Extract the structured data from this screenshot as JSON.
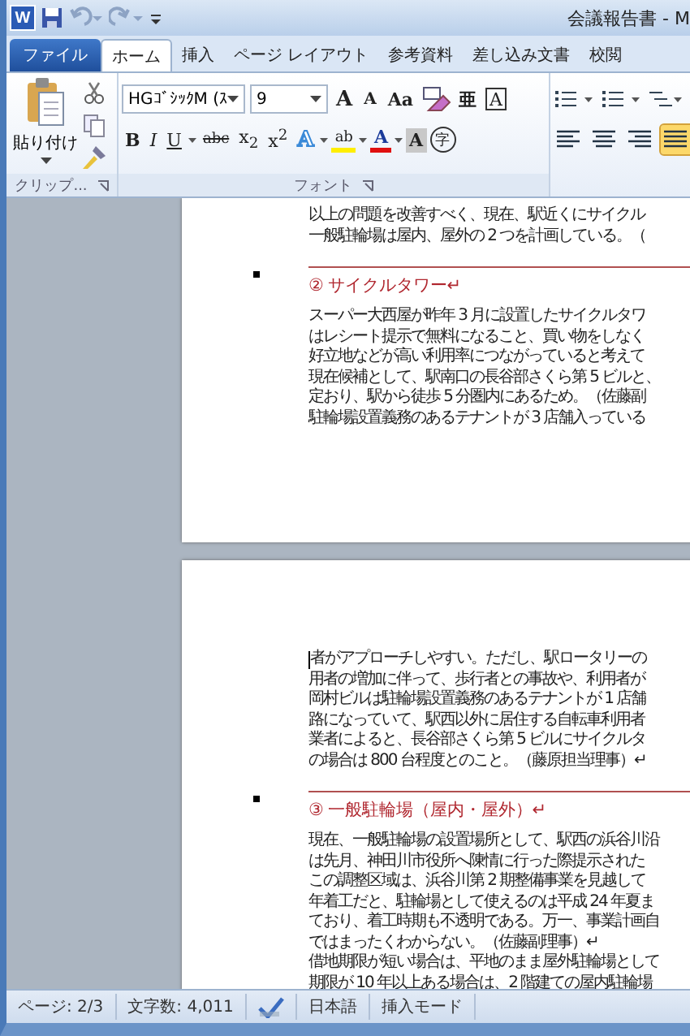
{
  "window": {
    "app_icon": "W",
    "title": "会議報告書 - M"
  },
  "tabs": [
    {
      "label": "ファイル",
      "kind": "file",
      "selected": false
    },
    {
      "label": "ホーム",
      "kind": "tab",
      "selected": true
    },
    {
      "label": "挿入",
      "kind": "tab",
      "selected": false
    },
    {
      "label": "ページ レイアウト",
      "kind": "tab",
      "selected": false
    },
    {
      "label": "参考資料",
      "kind": "tab",
      "selected": false
    },
    {
      "label": "差し込み文書",
      "kind": "tab",
      "selected": false
    },
    {
      "label": "校閲",
      "kind": "tab",
      "selected": false
    }
  ],
  "clipboard": {
    "paste_label": "貼り付け",
    "group_label": "クリップ..."
  },
  "font": {
    "font_name": "HGｺﾞｼｯｸM (ｽ",
    "font_size": "9",
    "group_label": "フォント",
    "row1": [
      {
        "label": "A",
        "kind": "grow"
      },
      {
        "label": "A",
        "kind": "shrink"
      },
      {
        "label": "Aa",
        "kind": "case"
      },
      {
        "kind": "clear"
      },
      {
        "label": "亜",
        "kind": "ruby"
      },
      {
        "label": "A",
        "kind": "border"
      }
    ],
    "row2": [
      {
        "label": "B",
        "kind": "bold"
      },
      {
        "label": "I",
        "kind": "italic"
      },
      {
        "label": "U",
        "kind": "underline"
      },
      {
        "label": "abc",
        "kind": "strike"
      },
      {
        "label": "x$_{2}$",
        "kind": "plain"
      },
      {
        "label": "x$^{2}$",
        "kind": "plain"
      },
      {
        "label": "A",
        "kind": "effects"
      },
      {
        "label": "ab",
        "kind": "highlight"
      },
      {
        "label": "A",
        "kind": "color"
      },
      {
        "label": "A",
        "kind": "shade"
      },
      {
        "label": "字",
        "kind": "enclose"
      }
    ]
  },
  "paragraph": {
    "align": [
      {
        "selected": false
      },
      {
        "selected": false
      },
      {
        "selected": false
      },
      {
        "selected": true
      }
    ]
  },
  "pages": [
    {
      "blocks": [
        {
          "kind": "body",
          "lines": [
            "以上の問題を改善すべく、現在、駅近くにサイクル",
            "一般駐輪場は屋内、屋外の 2 つを計画している。（"
          ]
        },
        {
          "kind": "heading",
          "text": "② サイクルタワー↵"
        },
        {
          "kind": "body",
          "lines": [
            "スーパー大西屋が昨年 3 月に設置したサイクルタワ",
            "はレシート提示で無料になること、買い物をしなく",
            "好立地などが高い利用率につながっていると考えて",
            "現在候補として、駅南口の長谷部さくら第 5 ビルと、",
            "定おり、駅から徒歩 5 分圏内にあるため。（佐藤副",
            "駐輪場設置義務のあるテナントが 3 店舗入っている"
          ]
        }
      ]
    },
    {
      "blocks": [
        {
          "kind": "body",
          "cursor": true,
          "lines": [
            "者がアプローチしやすい。ただし、駅ロータリーの",
            "用者の増加に伴って、歩行者との事故や、利用者が",
            "岡村ビルは駐輪場設置義務のあるテナントが 1 店舗",
            "路になっていて、駅西以外に居住する自転車利用者",
            "業者によると、長谷部さくら第 5 ビルにサイクルタ",
            "の場合は 800 台程度とのこと。（藤原担当理事）↵"
          ]
        },
        {
          "kind": "heading",
          "text": "③ 一般駐輪場（屋内・屋外）↵"
        },
        {
          "kind": "body",
          "lines": [
            "現在、一般駐輪場の設置場所として、駅西の浜谷川沿",
            "は先月、神田川市役所へ陳情に行った際提示された",
            "この調整区域は、浜谷川第 2 期整備事業を見越して",
            "年着工だと、駐輪場として使えるのは平成 24 年夏ま",
            "ており、着工時期も不透明である。万一、事業計画自",
            "ではまったくわからない。（佐藤副理事）↵",
            "借地期限が短い場合は、平地のまま屋外駐輪場として",
            "期限が 10 年以上ある場合は、2 階建ての屋内駐輪場"
          ]
        }
      ]
    }
  ],
  "status_bar": {
    "page": "ページ: 2/3",
    "words": "文字数: 4,011",
    "language": "日本語",
    "mode": "挿入モード"
  }
}
